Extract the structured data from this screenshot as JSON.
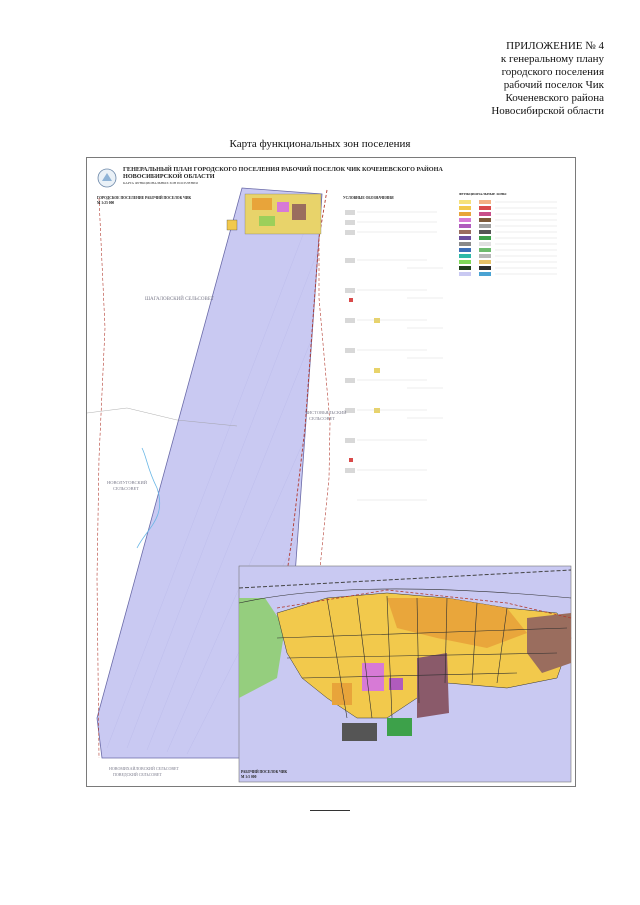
{
  "appendix": {
    "lines": [
      "ПРИЛОЖЕНИЕ № 4",
      "к генеральному плану",
      "городского поселения",
      "рабочий поселок Чик",
      "Коченевского района",
      "Новосибирской области"
    ]
  },
  "map_heading": "Карта функциональных зон поселения",
  "sheet": {
    "title_line1": "ГЕНЕРАЛЬНЫЙ ПЛАН ГОРОДСКОГО ПОСЕЛЕНИЯ РАБОЧИЙ ПОСЕЛОК ЧИК КОЧЕНЕВСКОГО РАЙОНА",
    "title_line2": "НОВОСИБИРСКОЙ ОБЛАСТИ",
    "subtitle": "КАРТА ФУНКЦИОНАЛЬНЫХ ЗОН ПОСЕЛЕНИЯ",
    "main_map_label": "ГОРОДСКОЕ ПОСЕЛЕНИЕ РАБОЧИЙ ПОСЕЛОК ЧИК",
    "main_map_scale": "М 1:25 000",
    "inset_label": "РАБОЧИЙ ПОСЕЛОК ЧИК",
    "inset_scale": "М 1:5 000",
    "legend_heading": "УСЛОВНЫЕ ОБОЗНАЧЕНИЯ",
    "zones_heading": "ФУНКЦИОНАЛЬНЫЕ ЗОНЫ"
  },
  "neighbors": {
    "west": "ШАГАЛОВСКИЙ СЕЛЬСОВЕТ",
    "east_line1": "ЧИСТОВЬЯЛЬСКИЙ",
    "east_line2": "СЕЛЬСОВЕТ",
    "southwest_line1": "НОВОЛУГОВСКИЙ",
    "southwest_line2": "СЕЛЬСОВЕТ",
    "south_line1": "НОВОМИХАЙЛОВСКИЙ СЕЛЬСОВЕТ",
    "south_line2": "ПОВЕДСКИЙ СЕЛЬСОВЕТ"
  },
  "colors": {
    "settlement_fill": "#c9c9f2",
    "residential": "#f2c94c",
    "residential_orange": "#e8a43a",
    "business": "#d77ad6",
    "industrial": "#9a6d5e",
    "recreation": "#9ccf5a",
    "border": "#b23a2f"
  }
}
